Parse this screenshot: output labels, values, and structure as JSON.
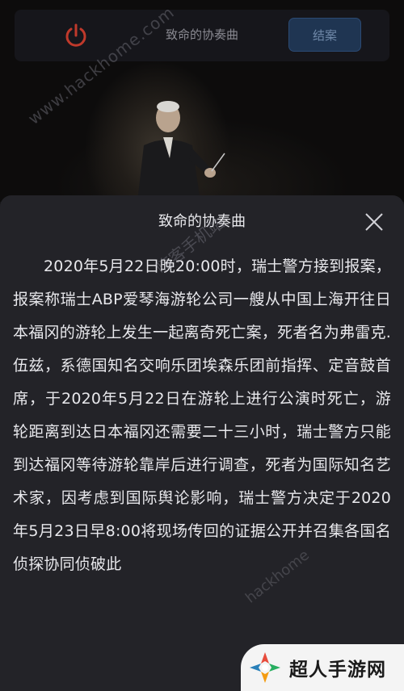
{
  "header": {
    "title": "致命的协奏曲",
    "close_case_label": "结案"
  },
  "watermark": {
    "text": "www.hackhome.com"
  },
  "modal": {
    "title": "致命的协奏曲",
    "body": "2020年5月22日晚20:00时，瑞士警方接到报案，报案称瑞士ABP爱琴海游轮公司一艘从中国上海开往日本福冈的游轮上发生一起离奇死亡案，死者名为弗雷克.伍兹，系德国知名交响乐团埃森乐团前指挥、定音鼓首席，于2020年5月22日在游轮上进行公演时死亡，游轮距离到达日本福冈还需要二十三小时，瑞士警方只能到达福冈等待游轮靠岸后进行调查，死者为国际知名艺术家，因考虑到国际舆论影响，瑞士警方决定于2020年5月23日早8:00将现场传回的证据公开并召集各国名侦探协同侦破此"
  },
  "site_logo": {
    "text": "超人手游网"
  },
  "colors": {
    "power_icon": "#c0392b",
    "close_case_button": "#1f3552",
    "modal_background": "#232328"
  }
}
